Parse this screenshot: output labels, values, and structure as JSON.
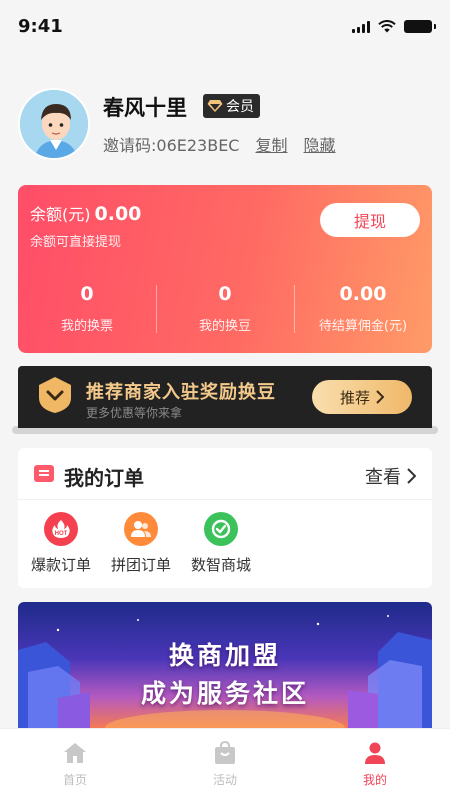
{
  "status_bar": {
    "time": "9:41"
  },
  "profile": {
    "name": "春风十里",
    "badge": "会员",
    "invite_text": "邀请码:06E23BEC",
    "copy_label": "复制",
    "hide_label": "隐藏"
  },
  "balance": {
    "label": "余额(元)",
    "value": "0.00",
    "subtitle": "余额可直接提现",
    "withdraw_label": "提现",
    "stats": [
      {
        "value": "0",
        "label": "我的换票"
      },
      {
        "value": "0",
        "label": "我的换豆"
      },
      {
        "value": "0.00",
        "label": "待结算佣金(元)"
      }
    ]
  },
  "promo": {
    "title": "推荐商家入驻奖励换豆",
    "subtitle": "更多优惠等你来拿",
    "button_label": "推荐"
  },
  "orders": {
    "title": "我的订单",
    "view_label": "查看",
    "items": [
      {
        "label": "爆款订单",
        "icon": "hot-icon",
        "color": "#f5404f"
      },
      {
        "label": "拼团订单",
        "icon": "group-icon",
        "color": "#ff8a3a"
      },
      {
        "label": "数智商城",
        "icon": "mall-icon",
        "color": "#3cc25a"
      }
    ]
  },
  "banner": {
    "line1": "换商加盟",
    "line2": "成为服务社区"
  },
  "tabbar": {
    "items": [
      {
        "label": "首页",
        "icon": "home-icon"
      },
      {
        "label": "活动",
        "icon": "bag-icon"
      },
      {
        "label": "我的",
        "icon": "user-icon",
        "active": true
      }
    ],
    "active_color": "#f04457"
  }
}
